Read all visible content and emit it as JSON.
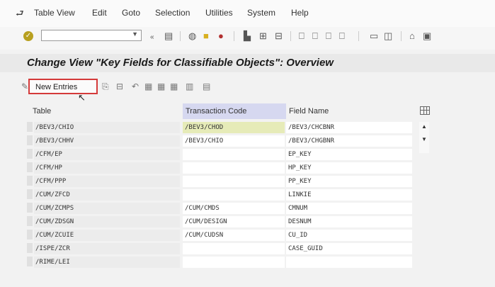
{
  "menubar": {
    "items": [
      "Table View",
      "Edit",
      "Goto",
      "Selection",
      "Utilities",
      "System",
      "Help"
    ]
  },
  "toolbar": {
    "command_field": ""
  },
  "title": "Change View \"Key Fields for Classifiable Objects\": Overview",
  "app_toolbar": {
    "new_entries_label": "New Entries"
  },
  "table": {
    "columns": [
      "Table",
      "Transaction Code",
      "Field Name"
    ],
    "rows": [
      {
        "table": "/BEV3/CHIO",
        "tcode": "/BEV3/CHOD",
        "field": "/BEV3/CHCBNR"
      },
      {
        "table": "/BEV3/CHHV",
        "tcode": "/BEV3/CHIO",
        "field": "/BEV3/CHGBNR"
      },
      {
        "table": "/CFM/EP",
        "tcode": "",
        "field": "EP_KEY"
      },
      {
        "table": "/CFM/HP",
        "tcode": "",
        "field": "HP_KEY"
      },
      {
        "table": "/CFM/PPP",
        "tcode": "",
        "field": "PP_KEY"
      },
      {
        "table": "/CUM/ZFCD",
        "tcode": "",
        "field": "LINKIE"
      },
      {
        "table": "/CUM/ZCMPS",
        "tcode": "/CUM/CMDS",
        "field": "CMNUM"
      },
      {
        "table": "/CUM/ZDSGN",
        "tcode": "/CUM/DESIGN",
        "field": "DESNUM"
      },
      {
        "table": "/CUM/ZCUIE",
        "tcode": "/CUM/CUDSN",
        "field": "CU_ID"
      },
      {
        "table": "/ISPE/ZCR",
        "tcode": "",
        "field": "CASE_GUID"
      },
      {
        "table": "/RIME/LEI",
        "tcode": "",
        "field": ""
      }
    ]
  }
}
